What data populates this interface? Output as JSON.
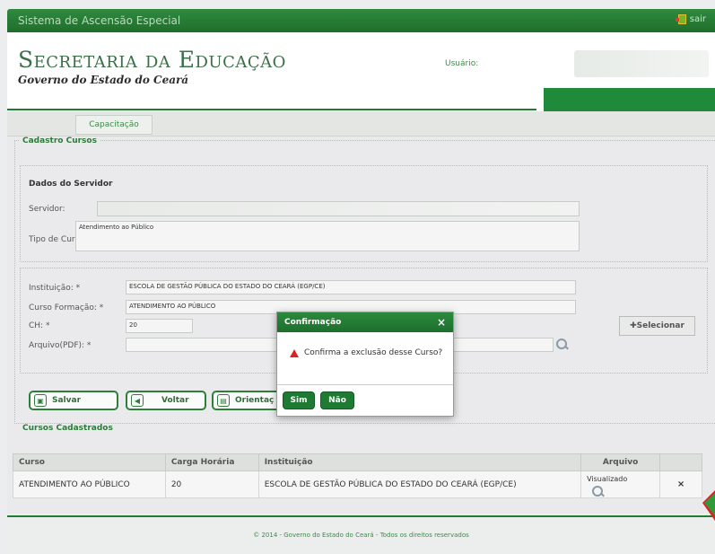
{
  "topbar": {
    "title": "Sistema de Ascensão Especial",
    "logout_label": "sair"
  },
  "header": {
    "brand_main": "Secretaria da Educação",
    "brand_sub": "Governo do Estado do Ceará",
    "user_label": "Usuário:"
  },
  "nav": {
    "tab_label": "Capacitação"
  },
  "form": {
    "legend": "Cadastro Cursos",
    "servidor_section": "Dados do Servidor",
    "servidor_label": "Servidor:",
    "tipo_curso_label": "Tipo de Curso",
    "tipo_curso_value": "Atendimento ao Público",
    "instituicao_label": "Instituição: *",
    "instituicao_value": "ESCOLA DE GESTÃO PÚBLICA DO ESTADO DO CEARÁ (EGP/CE)",
    "curso_formacao_label": "Curso Formação: *",
    "curso_formacao_value": "ATENDIMENTO AO PÚBLICO",
    "ch_label": "CH: *",
    "ch_value": "20",
    "arquivo_label": "Arquivo(PDF): *",
    "selecionar_label": "✚Selecionar"
  },
  "buttons": {
    "salvar": "Salvar",
    "voltar": "Voltar",
    "orientacoes": "Orientaç"
  },
  "cadastrados": {
    "legend": "Cursos Cadastrados",
    "headers": [
      "Curso",
      "Carga Horária",
      "Instituição",
      "Arquivo",
      ""
    ],
    "rows": [
      {
        "curso": "ATENDIMENTO AO PÚBLICO",
        "carga": "20",
        "instituicao": "ESCOLA DE GESTÃO PÚBLICA DO ESTADO DO CEARÁ (EGP/CE)",
        "arquivo": "Visualizado",
        "delete": "×"
      }
    ]
  },
  "dialog": {
    "title": "Confirmação",
    "close": "×",
    "message": "Confirma a exclusão desse Curso?",
    "yes": "Sim",
    "no": "Não"
  },
  "footer": {
    "text": "© 2014 - Governo do Estado do Ceará - Todos os direitos reservados"
  },
  "colors": {
    "brand_green": "#1f7a33",
    "danger": "#d22222"
  }
}
